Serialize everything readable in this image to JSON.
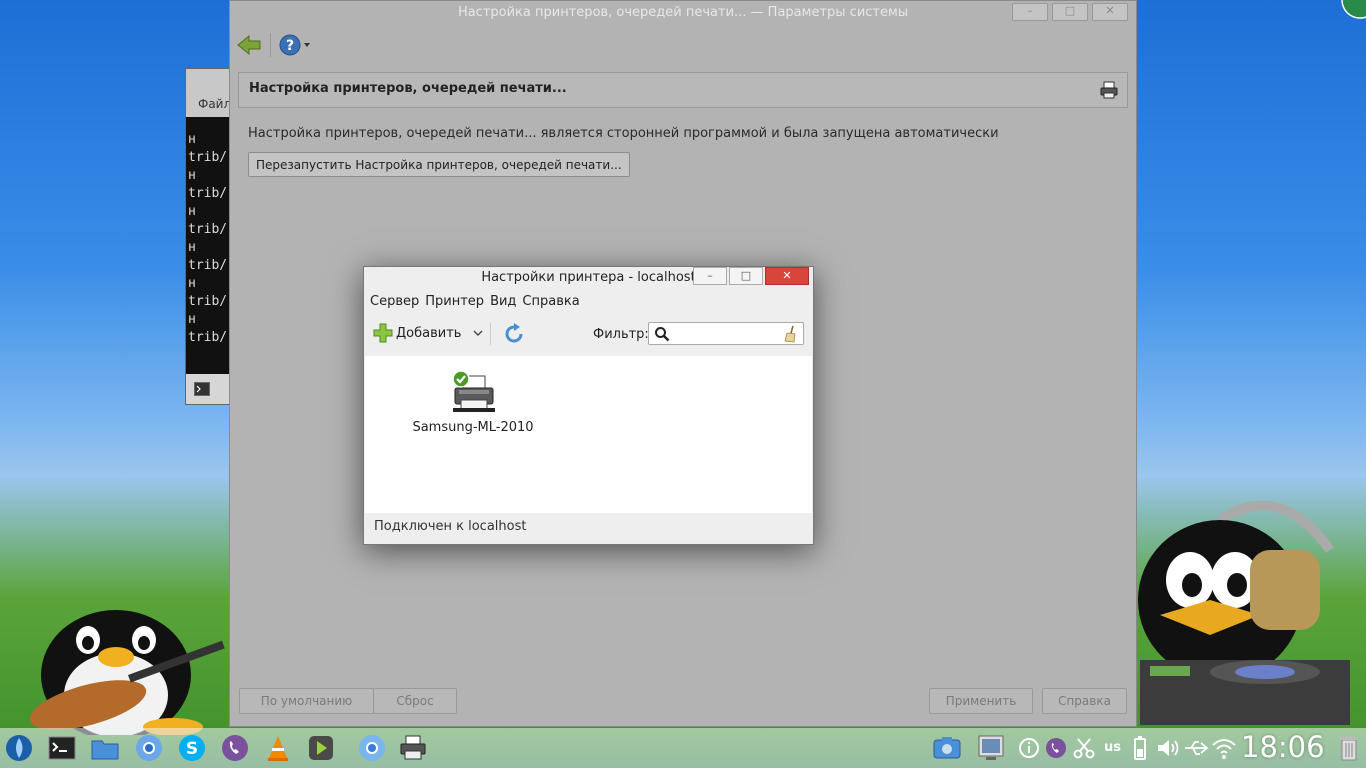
{
  "main_window": {
    "title": "Настройка принтеров, очередей печати... — Параметры системы",
    "panel_title": "Настройка принтеров, очередей печати...",
    "message": "Настройка принтеров, очередей печати... является сторонней программой и была запущена автоматически",
    "restart_label": "Перезапустить Настройка принтеров, очередей печати...",
    "defaults_label": "По умолчанию",
    "reset_label": "Сброс",
    "apply_label": "Применить",
    "help_label": "Справка"
  },
  "terminal": {
    "menu_label": "Файл",
    "lines": [
      "   н",
      "trib/",
      "   н",
      "trib/",
      "   н",
      "trib/",
      "   н",
      "trib/",
      "   н",
      "trib/",
      "   н",
      "trib/"
    ]
  },
  "dialog": {
    "title": "Настройки принтера - localhost",
    "menu": [
      "Сервер",
      "Принтер",
      "Вид",
      "Справка"
    ],
    "add_label": "Добавить",
    "filter_label": "Фильтр:",
    "filter_value": "",
    "printer_name": "Samsung-ML-2010",
    "status": "Подключен к localhost"
  },
  "taskbar": {
    "clock": "18:06",
    "keyboard_layout": "us",
    "icons": [
      "start-icon",
      "terminal-icon",
      "files-icon",
      "chromium-icon",
      "skype-icon",
      "viber-icon",
      "vlc-icon",
      "player-icon",
      "chromium2-icon",
      "printer-icon"
    ],
    "tray_icons": [
      "screenshot-icon",
      "monitor-icon",
      "info-icon",
      "viber-tray-icon",
      "scissors-icon",
      "battery-icon",
      "volume-icon",
      "usb-icon",
      "wifi-icon",
      "trash-icon"
    ]
  },
  "colors": {
    "close_button": "#d9453b",
    "main_window_bg": "#b3b3b3",
    "dialog_bg": "#eeeeee"
  }
}
